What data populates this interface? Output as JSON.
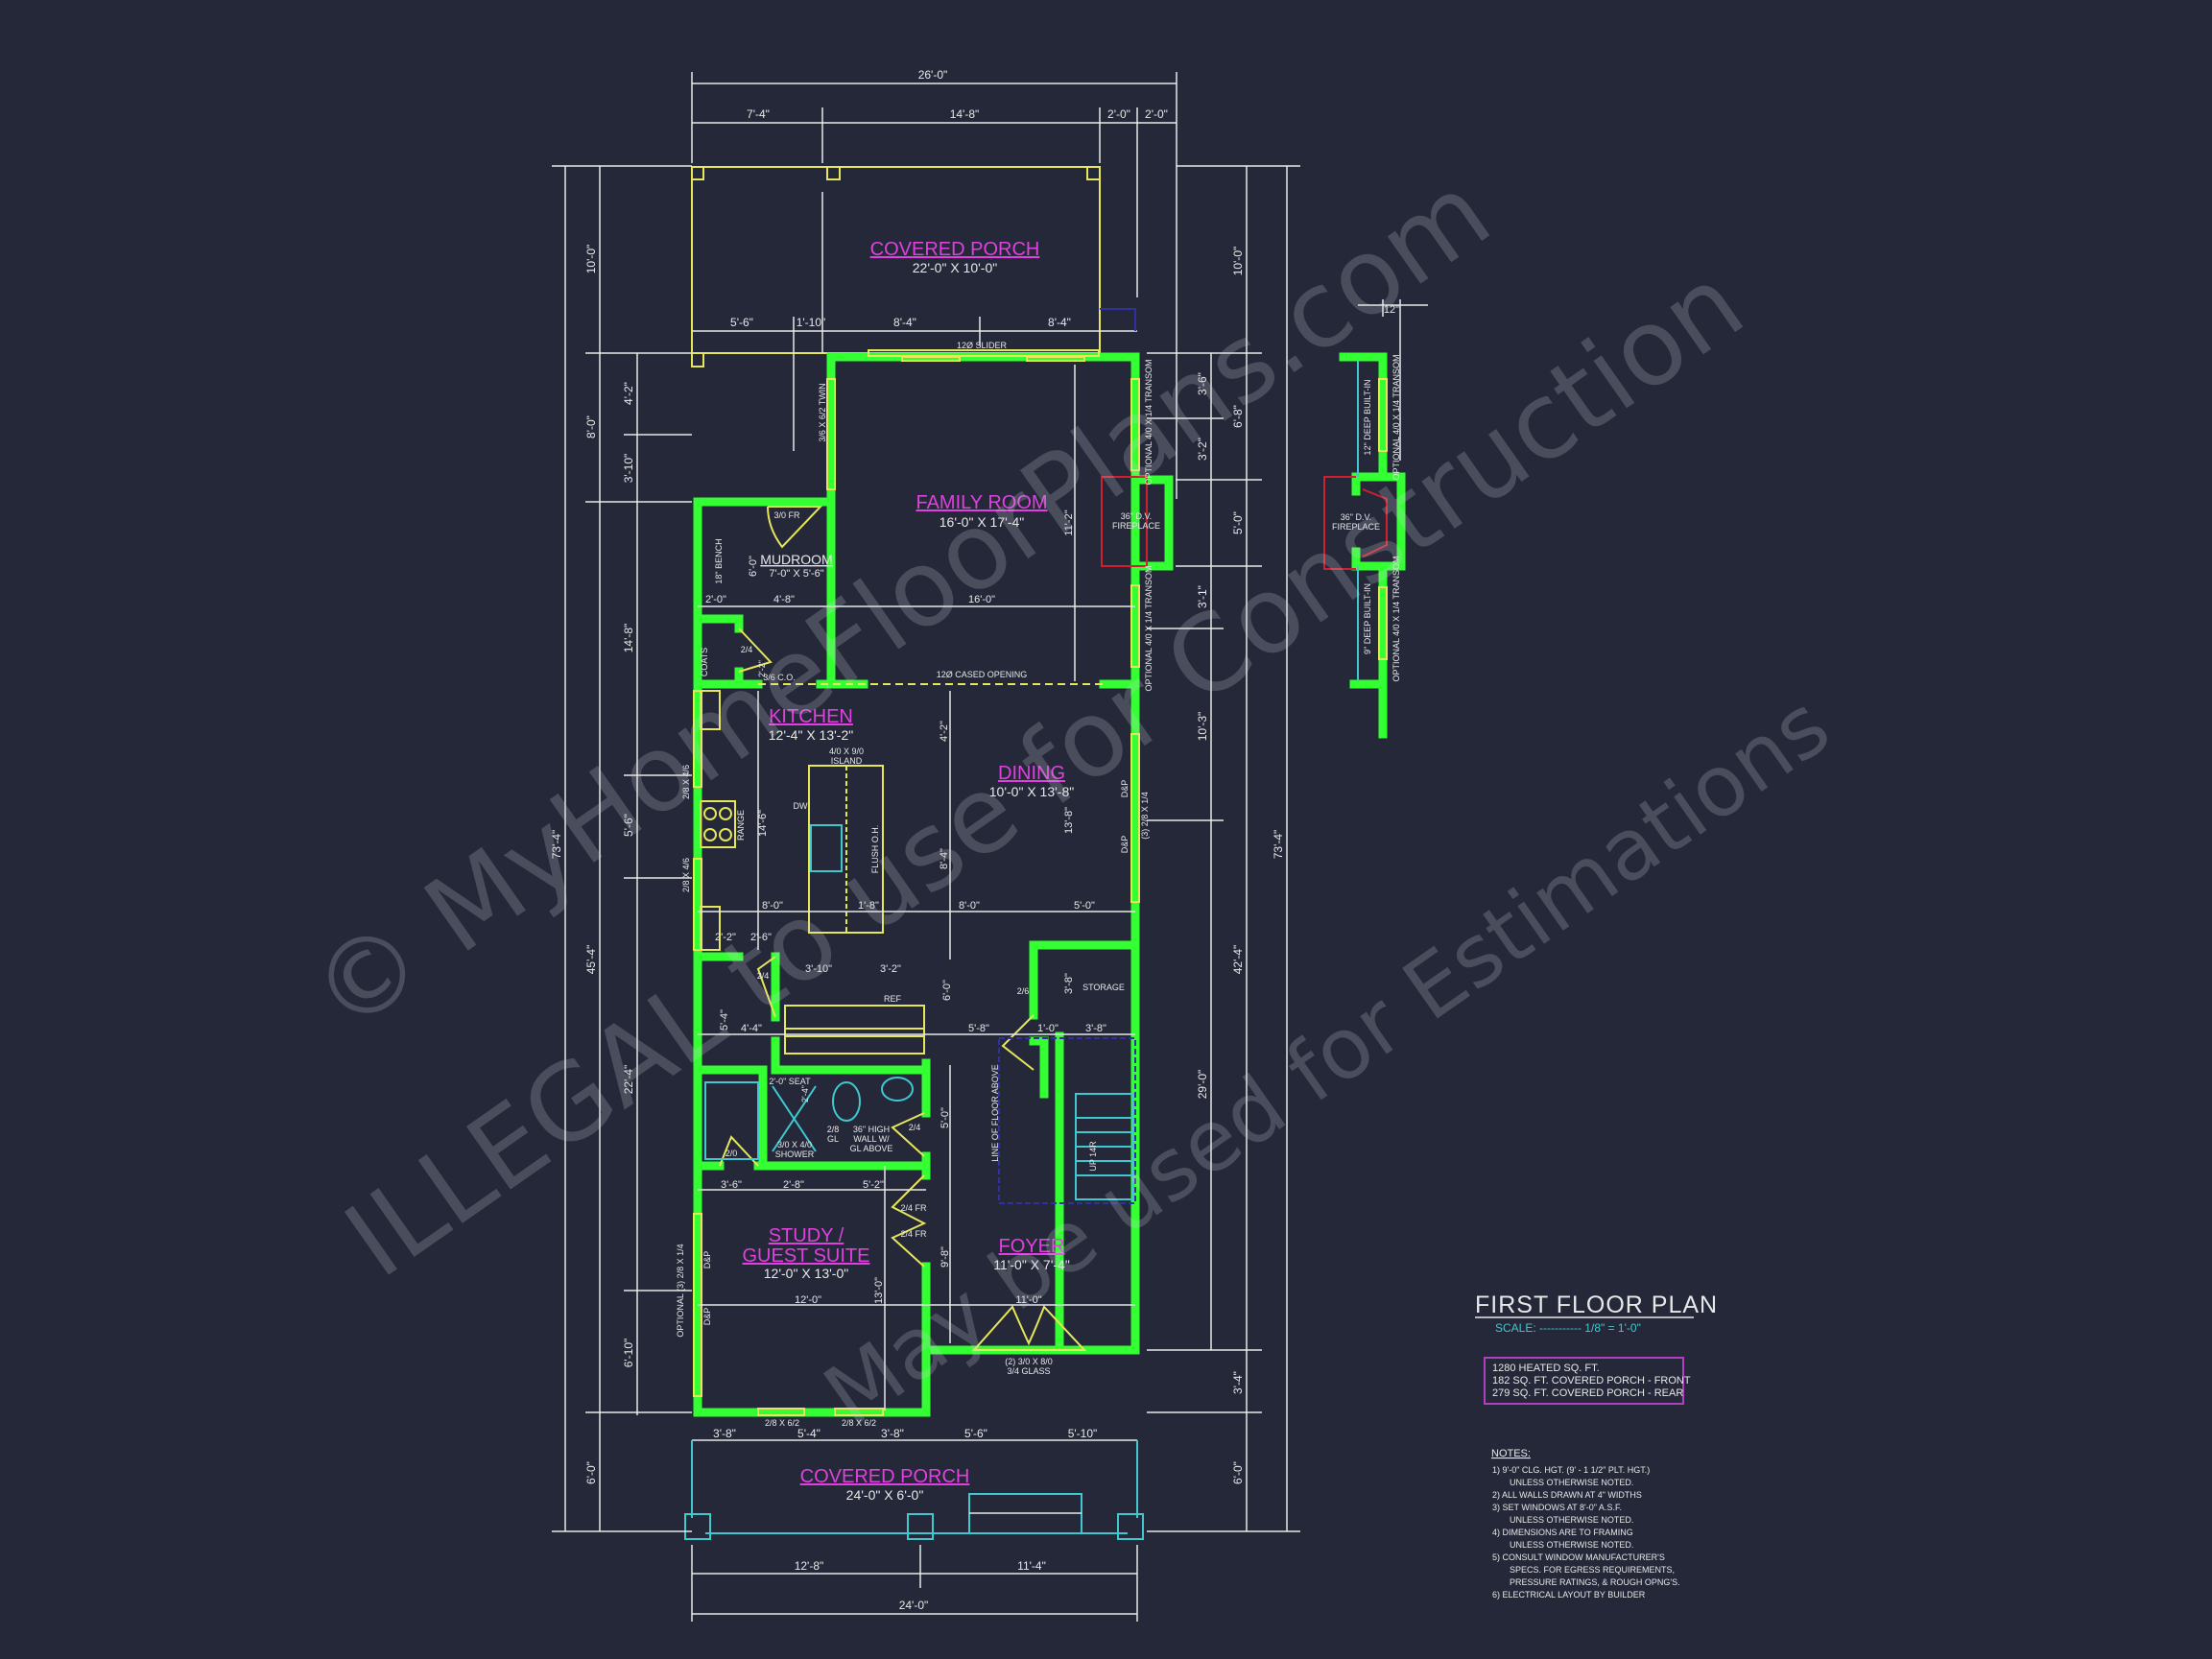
{
  "colors": {
    "background": "#252839",
    "walls": "#33ff33",
    "room_labels": "#e040e0",
    "windows_doors": "#e6e65a",
    "fixtures": "#40c8d0",
    "fireplace": "#d02030",
    "dimensions": "#e8e8e8"
  },
  "title": {
    "name": "FIRST FLOOR PLAN",
    "scale": "SCALE: ----------- 1/8\" = 1'-0\""
  },
  "areas": [
    "1280 HEATED SQ. FT.",
    "182 SQ. FT. COVERED PORCH - FRONT",
    "279 SQ. FT. COVERED PORCH - REAR"
  ],
  "notes": {
    "heading": "NOTES:",
    "lines": [
      "1) 9'-0\" CLG. HGT. (9' - 1 1/2\" PLT. HGT.)",
      "UNLESS OTHERWISE NOTED.",
      "2) ALL WALLS DRAWN AT 4\" WIDTHS",
      "3) SET WINDOWS AT 8'-0\" A.S.F.",
      "UNLESS OTHERWISE NOTED.",
      "4) DIMENSIONS ARE TO FRAMING",
      "UNLESS OTHERWISE NOTED.",
      "5) CONSULT WINDOW MANUFACTURER'S",
      "SPECS. FOR EGRESS REQUIREMENTS,",
      "PRESSURE RATINGS, & ROUGH OPNG'S.",
      "6) ELECTRICAL LAYOUT BY BUILDER"
    ]
  },
  "rooms": {
    "rear_porch": {
      "name": "COVERED PORCH",
      "size": "22'-0\" X 10'-0\""
    },
    "family_room": {
      "name": "FAMILY ROOM",
      "size": "16'-0\" X 17'-4\""
    },
    "mudroom": {
      "name": "MUDROOM",
      "size": "7'-0\" X 5'-6\""
    },
    "kitchen": {
      "name": "KITCHEN",
      "size": "12'-4\" X 13'-2\""
    },
    "dining": {
      "name": "DINING",
      "size": "10'-0\" X 13'-8\""
    },
    "study": {
      "name_line1": "STUDY /",
      "name_line2": "GUEST SUITE",
      "size": "12'-0\" X 13'-0\""
    },
    "foyer": {
      "name": "FOYER",
      "size": "11'-0\" X 7'-4\""
    },
    "front_porch": {
      "name": "COVERED PORCH",
      "size": "24'-0\" X 6'-0\""
    }
  },
  "dims": {
    "top_overall": "26'-0\"",
    "top_row": [
      "7'-4\"",
      "14'-8\"",
      "2'-0\"",
      "2'-0\""
    ],
    "porch_row": [
      "5'-6\"",
      "1'-10\"",
      "8'-4\"",
      "8'-4\""
    ],
    "left_outer": "73'-4\"",
    "left_mid": [
      "10'-0\"",
      "8'-0\"",
      "45'-4\"",
      "6'-0\""
    ],
    "left_inner": [
      "4'-2\"",
      "3'-10\"",
      "14'-8\"",
      "5'-6\"",
      "22'-4\"",
      "6'-10\""
    ],
    "right_outer": "73'-4\"",
    "right_mid": [
      "10'-0\"",
      "6'-8\"",
      "5'-0\"",
      "42'-4\"",
      "3'-4\"",
      "6'-0\""
    ],
    "right_inner": [
      "3'-6\"",
      "3'-2\"",
      "3'-1\"",
      "10'-3\"",
      "29'-0\""
    ],
    "bottom_row": [
      "3'-8\"",
      "5'-4\"",
      "3'-8\"",
      "5'-6\"",
      "5'-10\""
    ],
    "bottom_mid": [
      "12'-8\"",
      "11'-4\""
    ],
    "bottom_overall": "24'-0\""
  },
  "labels": {
    "slider": "12Ø SLIDER",
    "twin": "3/6 X 6/2 TWIN",
    "fr_3": "3/0 FR",
    "bench": "18\" BENCH",
    "mud_h": "6'-0\"",
    "mud_w1": "2'-0\"",
    "mud_w2": "4'-8\"",
    "fam_w": "16'-0\"",
    "fam_h": "11'-2\"",
    "transom": "OPTIONAL 4/0 X 1/4 TRANSOM",
    "fireplace1": "36\" D.V.",
    "fireplace2": "FIREPLACE",
    "coats": "COATS",
    "d24": "2/4",
    "d22": "2'-2\"",
    "co": "3/6 C.O.",
    "cased": "12Ø CASED OPENING",
    "island1": "4/0 X 9/0",
    "island2": "ISLAND",
    "dw": "DW",
    "range": "RANGE",
    "k_h": "14'-6\"",
    "flush": "FLUSH O.H.",
    "d_42": "4'-2\"",
    "d_84": "8'-4\"",
    "d_138": "13'-8\"",
    "dp": "D&P",
    "din_win": "(3) 2/8 X 1/4",
    "r80a": "8'-0\"",
    "r18": "1'-8\"",
    "r80b": "8'-0\"",
    "r50": "5'-0\"",
    "r22": "2'-2\"",
    "r26": "2'-6\"",
    "r310": "3'-10\"",
    "r32": "3'-2\"",
    "ref": "REF",
    "d24b": "2/4",
    "d26": "2/6",
    "storage": "STORAGE",
    "st38": "3'-8\"",
    "r54": "5'-4\"",
    "r44": "4'-4\"",
    "r60": "6'-0\"",
    "r58": "5'-8\"",
    "r10": "1'-0\"",
    "r38": "3'-8\"",
    "left_win": "2/8 X 4/6",
    "seat": "2'-0\" SEAT",
    "seat_h": "2'-4\"",
    "shower1": "3/0 X 4/0",
    "shower2": "SHOWER",
    "gl1": "2/8",
    "gl2": "GL",
    "wall1": "36\" HIGH",
    "wall2": "WALL W/",
    "wall3": "GL ABOVE",
    "d24c": "2/4",
    "d20": "2/0",
    "b50": "5'-0\"",
    "floor_above": "LINE OF FLOOR ABOVE",
    "up": "UP 14R",
    "s36": "3'-6\"",
    "s28": "2'-8\"",
    "s52": "5'-2\"",
    "fr24": "2/4 FR",
    "study_w": "12'-0\"",
    "study_h": "13'-0\"",
    "foy_h": "9'-8\"",
    "foy_w": "11'-0\"",
    "study_win": "OPTIONAL (3) 2/8 X 1/4",
    "entry1": "(2) 3/0 X 8/0",
    "entry2": "3/4 GLASS",
    "win_front": "2/8 X 6/2"
  },
  "side_detail": {
    "depth": "12\"",
    "builtin_top": "12\" DEEP BUILT-IN",
    "builtin_bottom": "9\" DEEP BUILT-IN",
    "transom": "OPTIONAL 4/0 X 1/4 TRANSOM",
    "fireplace1": "36\" D.V.",
    "fireplace2": "FIREPLACE"
  },
  "watermark": [
    "© MyHomeFloorPlans.com",
    "ILLEGAL to use for Construction",
    "May be used for Estimations"
  ]
}
